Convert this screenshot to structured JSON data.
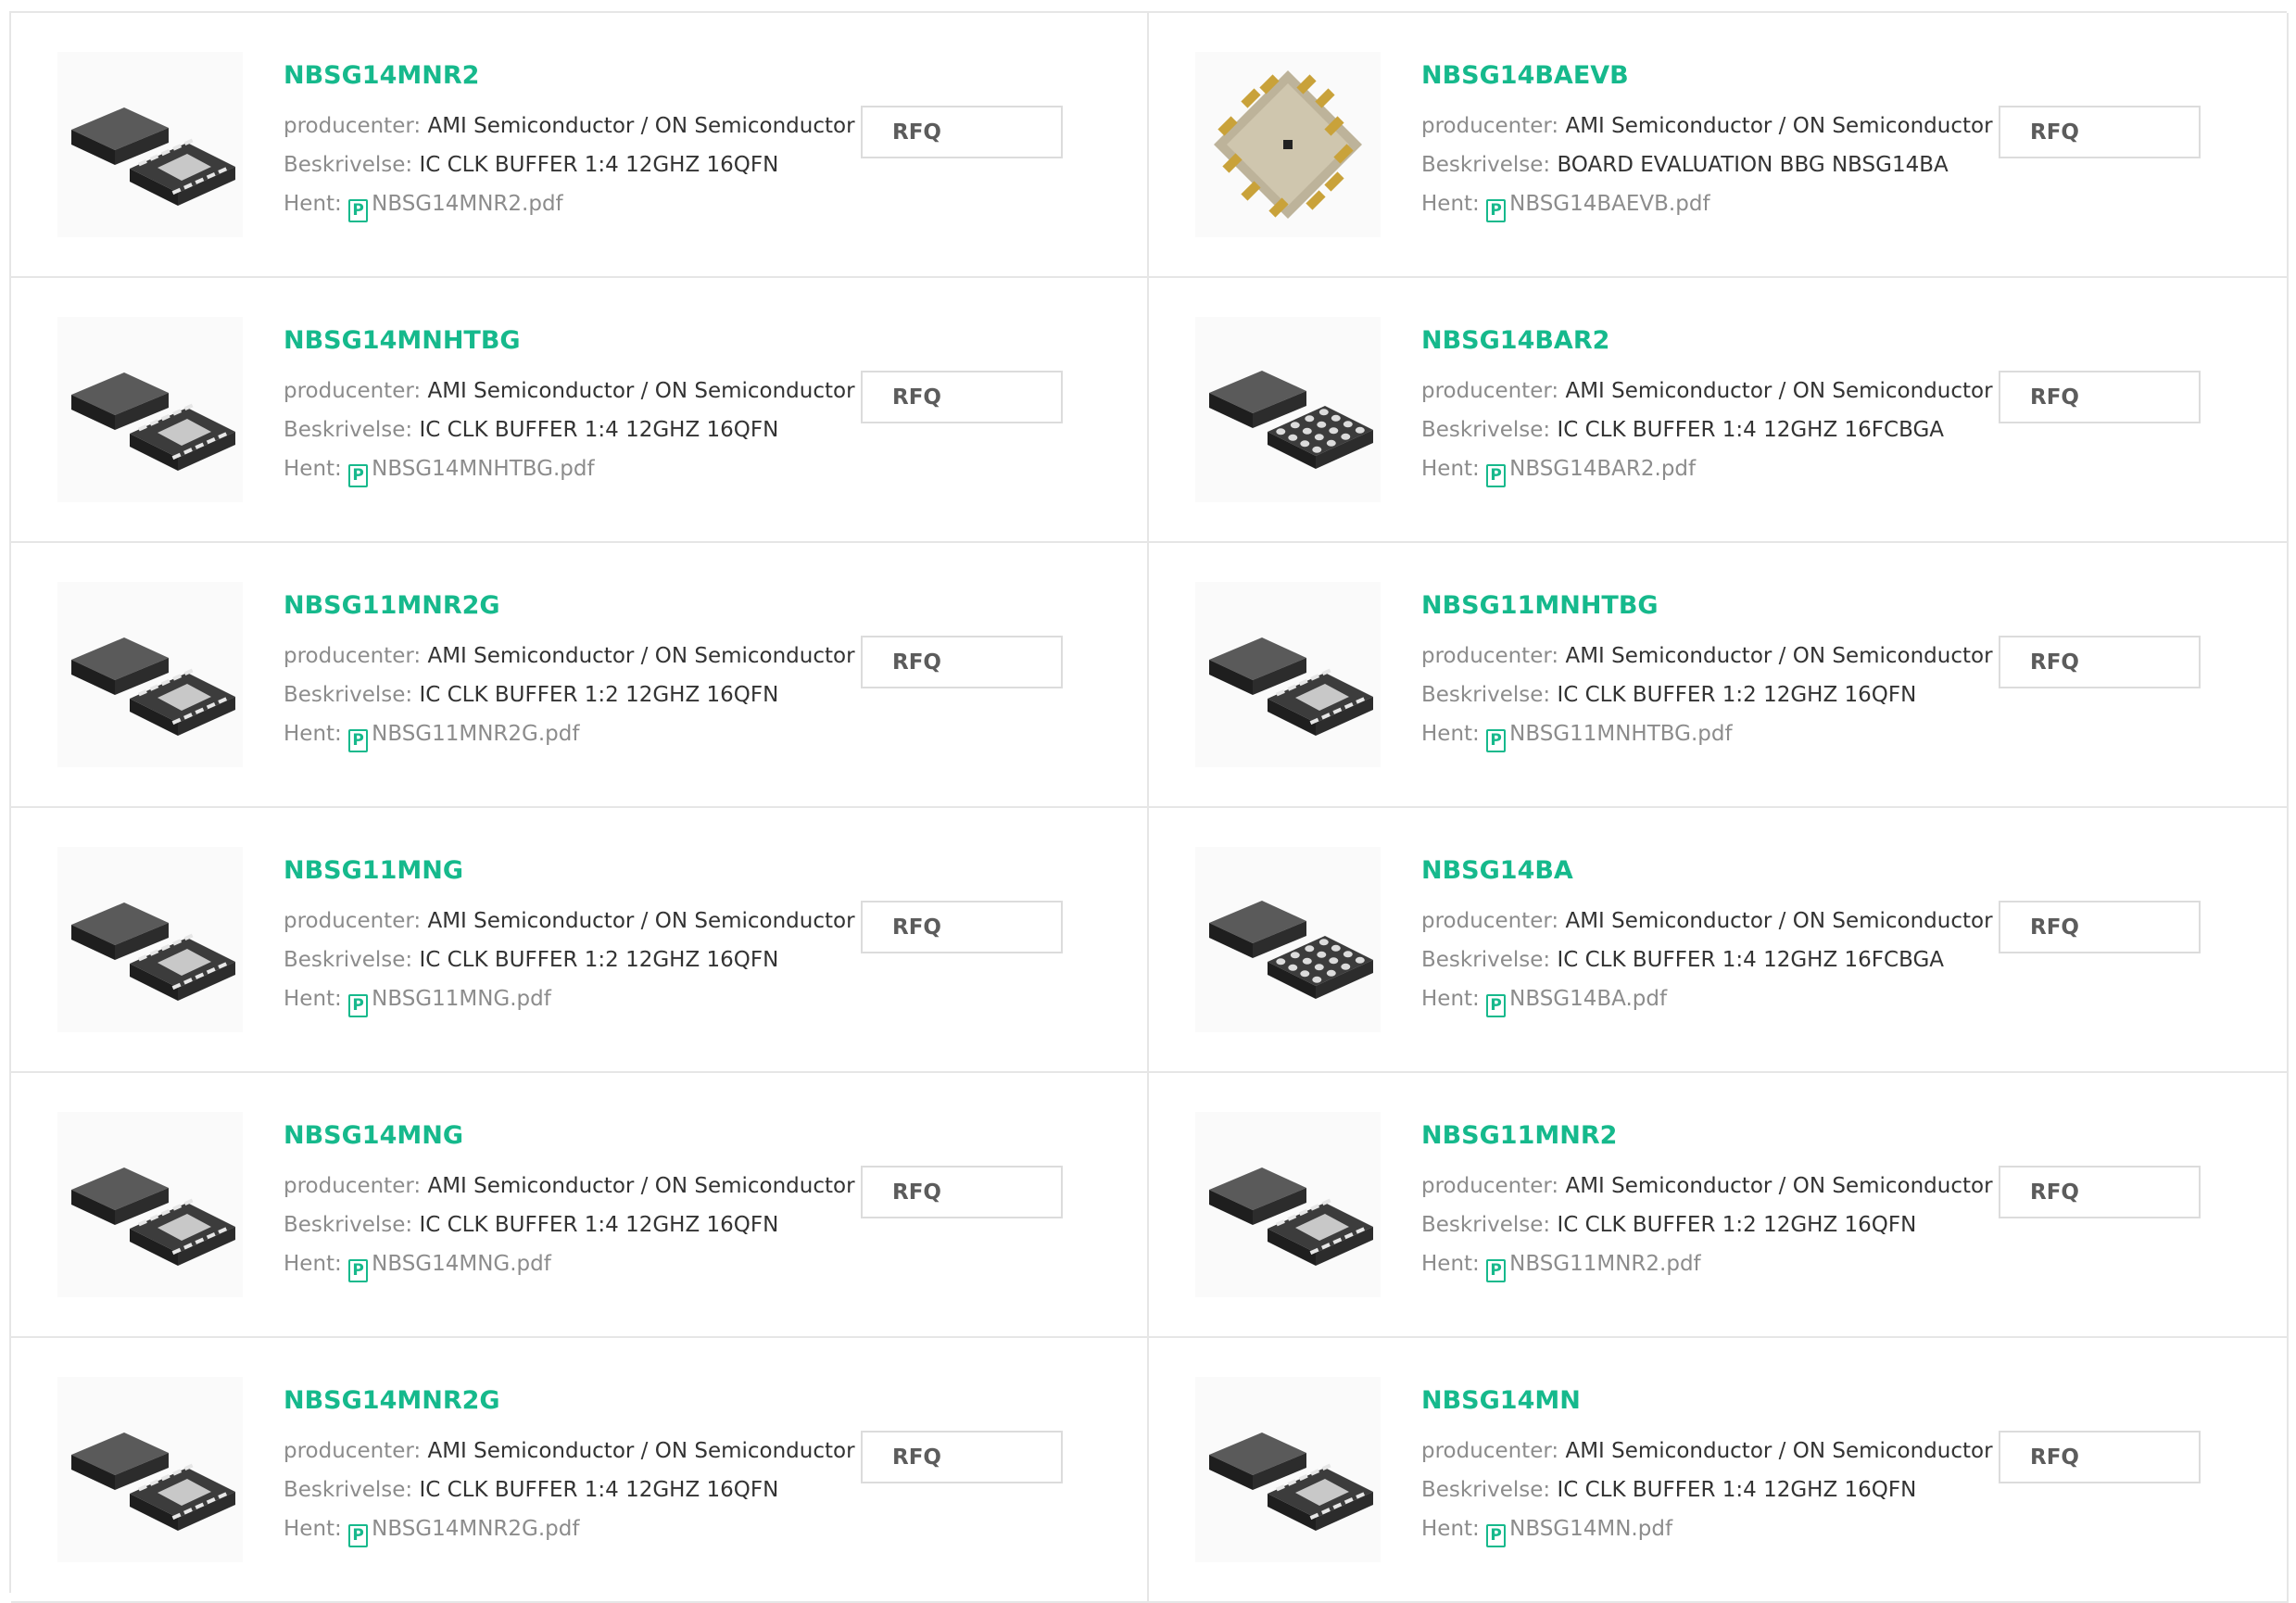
{
  "labels": {
    "manufacturer": "producenter:",
    "description": "Beskrivelse:",
    "download": "Hent:",
    "pdf_icon": "P",
    "rfq": "RFQ"
  },
  "colors": {
    "accent": "#16b98c",
    "label_gray": "#8c8c8c",
    "text": "#333333",
    "border": "#e6e6e6"
  },
  "products": [
    {
      "name": "NBSG14MNR2",
      "manufacturer": "AMI Semiconductor / ON Semiconductor",
      "description": "IC CLK BUFFER 1:4 12GHZ 16QFN",
      "file": "NBSG14MNR2.pdf",
      "image": "qfn-chip-icon"
    },
    {
      "name": "NBSG14BAEVB",
      "manufacturer": "AMI Semiconductor / ON Semiconductor",
      "description": "BOARD EVALUATION BBG NBSG14BA",
      "file": "NBSG14BAEVB.pdf",
      "image": "evaluation-board-icon"
    },
    {
      "name": "NBSG14MNHTBG",
      "manufacturer": "AMI Semiconductor / ON Semiconductor",
      "description": "IC CLK BUFFER 1:4 12GHZ 16QFN",
      "file": "NBSG14MNHTBG.pdf",
      "image": "qfn-chip-icon"
    },
    {
      "name": "NBSG14BAR2",
      "manufacturer": "AMI Semiconductor / ON Semiconductor",
      "description": "IC CLK BUFFER 1:4 12GHZ 16FCBGA",
      "file": "NBSG14BAR2.pdf",
      "image": "bga-chip-icon"
    },
    {
      "name": "NBSG11MNR2G",
      "manufacturer": "AMI Semiconductor / ON Semiconductor",
      "description": "IC CLK BUFFER 1:2 12GHZ 16QFN",
      "file": "NBSG11MNR2G.pdf",
      "image": "qfn-chip-icon"
    },
    {
      "name": "NBSG11MNHTBG",
      "manufacturer": "AMI Semiconductor / ON Semiconductor",
      "description": "IC CLK BUFFER 1:2 12GHZ 16QFN",
      "file": "NBSG11MNHTBG.pdf",
      "image": "qfn-chip-icon"
    },
    {
      "name": "NBSG11MNG",
      "manufacturer": "AMI Semiconductor / ON Semiconductor",
      "description": "IC CLK BUFFER 1:2 12GHZ 16QFN",
      "file": "NBSG11MNG.pdf",
      "image": "qfn-chip-icon"
    },
    {
      "name": "NBSG14BA",
      "manufacturer": "AMI Semiconductor / ON Semiconductor",
      "description": "IC CLK BUFFER 1:4 12GHZ 16FCBGA",
      "file": "NBSG14BA.pdf",
      "image": "bga-chip-icon"
    },
    {
      "name": "NBSG14MNG",
      "manufacturer": "AMI Semiconductor / ON Semiconductor",
      "description": "IC CLK BUFFER 1:4 12GHZ 16QFN",
      "file": "NBSG14MNG.pdf",
      "image": "qfn-chip-icon"
    },
    {
      "name": "NBSG11MNR2",
      "manufacturer": "AMI Semiconductor / ON Semiconductor",
      "description": "IC CLK BUFFER 1:2 12GHZ 16QFN",
      "file": "NBSG11MNR2.pdf",
      "image": "qfn-chip-icon"
    },
    {
      "name": "NBSG14MNR2G",
      "manufacturer": "AMI Semiconductor / ON Semiconductor",
      "description": "IC CLK BUFFER 1:4 12GHZ 16QFN",
      "file": "NBSG14MNR2G.pdf",
      "image": "qfn-chip-icon"
    },
    {
      "name": "NBSG14MN",
      "manufacturer": "AMI Semiconductor / ON Semiconductor",
      "description": "IC CLK BUFFER 1:4 12GHZ 16QFN",
      "file": "NBSG14MN.pdf",
      "image": "qfn-chip-icon"
    }
  ]
}
